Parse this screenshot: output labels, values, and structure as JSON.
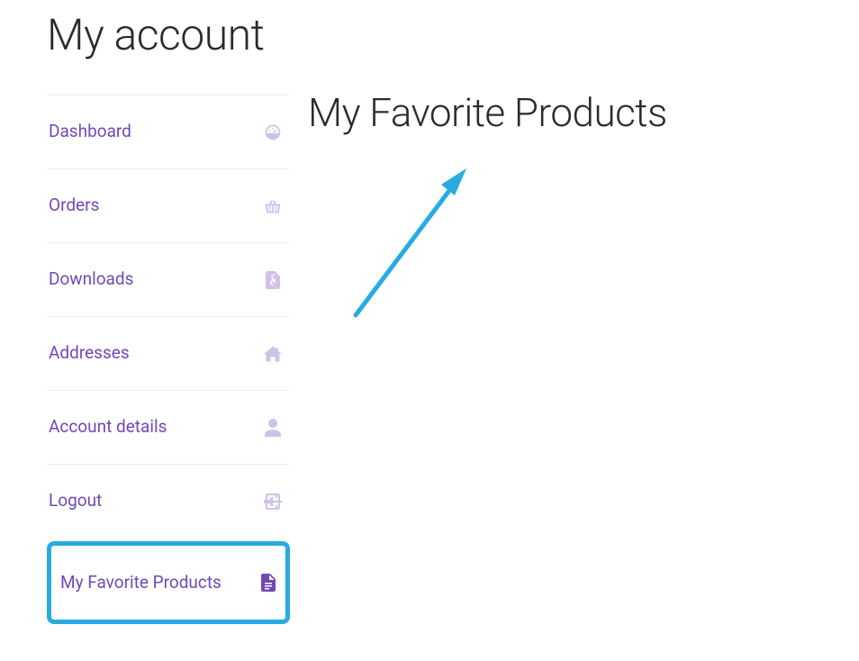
{
  "page": {
    "title": "My account"
  },
  "sidebar": {
    "items": [
      {
        "label": "Dashboard",
        "icon": "dashboard-icon"
      },
      {
        "label": "Orders",
        "icon": "basket-icon"
      },
      {
        "label": "Downloads",
        "icon": "file-archive-icon"
      },
      {
        "label": "Addresses",
        "icon": "home-icon"
      },
      {
        "label": "Account details",
        "icon": "user-icon"
      },
      {
        "label": "Logout",
        "icon": "signout-icon"
      },
      {
        "label": "My Favorite Products",
        "icon": "file-icon",
        "highlighted": true
      }
    ]
  },
  "content": {
    "heading": "My Favorite Products"
  },
  "annotation": {
    "color": "#29abe2"
  }
}
